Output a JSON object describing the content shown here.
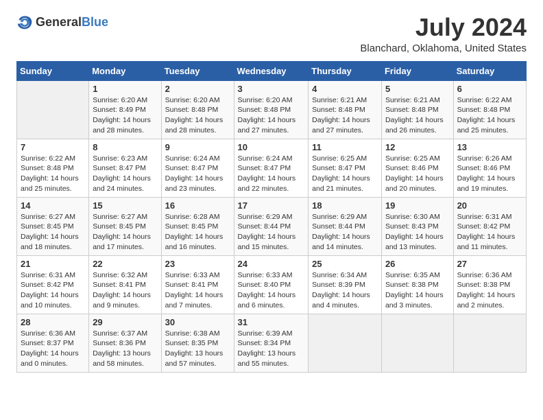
{
  "header": {
    "logo_general": "General",
    "logo_blue": "Blue",
    "title": "July 2024",
    "subtitle": "Blanchard, Oklahoma, United States"
  },
  "columns": [
    "Sunday",
    "Monday",
    "Tuesday",
    "Wednesday",
    "Thursday",
    "Friday",
    "Saturday"
  ],
  "weeks": [
    [
      {
        "num": "",
        "info": ""
      },
      {
        "num": "1",
        "info": "Sunrise: 6:20 AM\nSunset: 8:49 PM\nDaylight: 14 hours\nand 28 minutes."
      },
      {
        "num": "2",
        "info": "Sunrise: 6:20 AM\nSunset: 8:48 PM\nDaylight: 14 hours\nand 28 minutes."
      },
      {
        "num": "3",
        "info": "Sunrise: 6:20 AM\nSunset: 8:48 PM\nDaylight: 14 hours\nand 27 minutes."
      },
      {
        "num": "4",
        "info": "Sunrise: 6:21 AM\nSunset: 8:48 PM\nDaylight: 14 hours\nand 27 minutes."
      },
      {
        "num": "5",
        "info": "Sunrise: 6:21 AM\nSunset: 8:48 PM\nDaylight: 14 hours\nand 26 minutes."
      },
      {
        "num": "6",
        "info": "Sunrise: 6:22 AM\nSunset: 8:48 PM\nDaylight: 14 hours\nand 25 minutes."
      }
    ],
    [
      {
        "num": "7",
        "info": "Sunrise: 6:22 AM\nSunset: 8:48 PM\nDaylight: 14 hours\nand 25 minutes."
      },
      {
        "num": "8",
        "info": "Sunrise: 6:23 AM\nSunset: 8:47 PM\nDaylight: 14 hours\nand 24 minutes."
      },
      {
        "num": "9",
        "info": "Sunrise: 6:24 AM\nSunset: 8:47 PM\nDaylight: 14 hours\nand 23 minutes."
      },
      {
        "num": "10",
        "info": "Sunrise: 6:24 AM\nSunset: 8:47 PM\nDaylight: 14 hours\nand 22 minutes."
      },
      {
        "num": "11",
        "info": "Sunrise: 6:25 AM\nSunset: 8:47 PM\nDaylight: 14 hours\nand 21 minutes."
      },
      {
        "num": "12",
        "info": "Sunrise: 6:25 AM\nSunset: 8:46 PM\nDaylight: 14 hours\nand 20 minutes."
      },
      {
        "num": "13",
        "info": "Sunrise: 6:26 AM\nSunset: 8:46 PM\nDaylight: 14 hours\nand 19 minutes."
      }
    ],
    [
      {
        "num": "14",
        "info": "Sunrise: 6:27 AM\nSunset: 8:45 PM\nDaylight: 14 hours\nand 18 minutes."
      },
      {
        "num": "15",
        "info": "Sunrise: 6:27 AM\nSunset: 8:45 PM\nDaylight: 14 hours\nand 17 minutes."
      },
      {
        "num": "16",
        "info": "Sunrise: 6:28 AM\nSunset: 8:45 PM\nDaylight: 14 hours\nand 16 minutes."
      },
      {
        "num": "17",
        "info": "Sunrise: 6:29 AM\nSunset: 8:44 PM\nDaylight: 14 hours\nand 15 minutes."
      },
      {
        "num": "18",
        "info": "Sunrise: 6:29 AM\nSunset: 8:44 PM\nDaylight: 14 hours\nand 14 minutes."
      },
      {
        "num": "19",
        "info": "Sunrise: 6:30 AM\nSunset: 8:43 PM\nDaylight: 14 hours\nand 13 minutes."
      },
      {
        "num": "20",
        "info": "Sunrise: 6:31 AM\nSunset: 8:42 PM\nDaylight: 14 hours\nand 11 minutes."
      }
    ],
    [
      {
        "num": "21",
        "info": "Sunrise: 6:31 AM\nSunset: 8:42 PM\nDaylight: 14 hours\nand 10 minutes."
      },
      {
        "num": "22",
        "info": "Sunrise: 6:32 AM\nSunset: 8:41 PM\nDaylight: 14 hours\nand 9 minutes."
      },
      {
        "num": "23",
        "info": "Sunrise: 6:33 AM\nSunset: 8:41 PM\nDaylight: 14 hours\nand 7 minutes."
      },
      {
        "num": "24",
        "info": "Sunrise: 6:33 AM\nSunset: 8:40 PM\nDaylight: 14 hours\nand 6 minutes."
      },
      {
        "num": "25",
        "info": "Sunrise: 6:34 AM\nSunset: 8:39 PM\nDaylight: 14 hours\nand 4 minutes."
      },
      {
        "num": "26",
        "info": "Sunrise: 6:35 AM\nSunset: 8:38 PM\nDaylight: 14 hours\nand 3 minutes."
      },
      {
        "num": "27",
        "info": "Sunrise: 6:36 AM\nSunset: 8:38 PM\nDaylight: 14 hours\nand 2 minutes."
      }
    ],
    [
      {
        "num": "28",
        "info": "Sunrise: 6:36 AM\nSunset: 8:37 PM\nDaylight: 14 hours\nand 0 minutes."
      },
      {
        "num": "29",
        "info": "Sunrise: 6:37 AM\nSunset: 8:36 PM\nDaylight: 13 hours\nand 58 minutes."
      },
      {
        "num": "30",
        "info": "Sunrise: 6:38 AM\nSunset: 8:35 PM\nDaylight: 13 hours\nand 57 minutes."
      },
      {
        "num": "31",
        "info": "Sunrise: 6:39 AM\nSunset: 8:34 PM\nDaylight: 13 hours\nand 55 minutes."
      },
      {
        "num": "",
        "info": ""
      },
      {
        "num": "",
        "info": ""
      },
      {
        "num": "",
        "info": ""
      }
    ]
  ]
}
